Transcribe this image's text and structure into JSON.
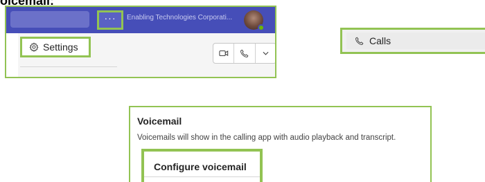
{
  "heading_cut": "oicemail:",
  "teams_header": {
    "more_label": "···",
    "org_name": "Enabling Technologies Corporati...",
    "settings_menu": {
      "settings_label": "Settings"
    }
  },
  "calls_nav": {
    "label": "Calls"
  },
  "voicemail": {
    "title": "Voicemail",
    "description": "Voicemails will show in the calling app with audio playback and transcript.",
    "configure_label": "Configure voicemail"
  },
  "colors": {
    "highlight": "#92c353",
    "header_bg": "#464eb8",
    "presence": "#6bb700"
  },
  "icons": [
    "more-options-icon",
    "gear-icon",
    "video-icon",
    "phone-icon",
    "chevron-down-icon",
    "avatar"
  ]
}
